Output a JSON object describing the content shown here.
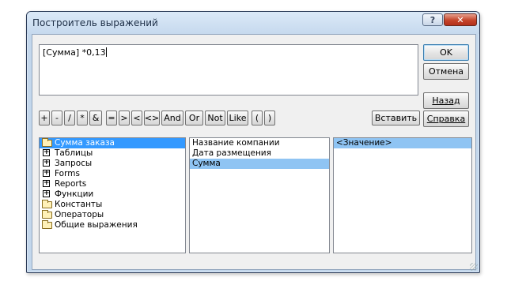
{
  "window": {
    "title": "Построитель выражений",
    "help_label": "?",
    "close_label": "✕"
  },
  "expression": {
    "value": "[Сумма] *0,13"
  },
  "buttons": {
    "ok": "OK",
    "cancel": "Отмена",
    "back": "Назад",
    "help": "Справка",
    "paste": "Вставить"
  },
  "operators": [
    "+",
    "-",
    "/",
    "*",
    "&",
    "=",
    ">",
    "<",
    "<>",
    "And",
    "Or",
    "Not",
    "Like",
    "(",
    ")"
  ],
  "tree": {
    "items": [
      {
        "label": "Сумма заказа",
        "icon": "open-folder-icon",
        "selected": true
      },
      {
        "label": "Таблицы",
        "icon": "expand-plus-icon"
      },
      {
        "label": "Запросы",
        "icon": "expand-plus-icon"
      },
      {
        "label": "Forms",
        "icon": "expand-plus-icon"
      },
      {
        "label": "Reports",
        "icon": "expand-plus-icon"
      },
      {
        "label": "Функции",
        "icon": "expand-plus-icon"
      },
      {
        "label": "Константы",
        "icon": "folder-icon"
      },
      {
        "label": "Операторы",
        "icon": "folder-icon"
      },
      {
        "label": "Общие выражения",
        "icon": "folder-icon"
      }
    ]
  },
  "fields": {
    "items": [
      "Название компании",
      "Дата размещения",
      "Сумма"
    ],
    "selected_index": 2
  },
  "values": {
    "items": [
      "<Значение>"
    ]
  },
  "colors": {
    "selection": "#3399ff",
    "inactive_selection": "#8fc4f3",
    "frame": "#c3d7ec"
  }
}
